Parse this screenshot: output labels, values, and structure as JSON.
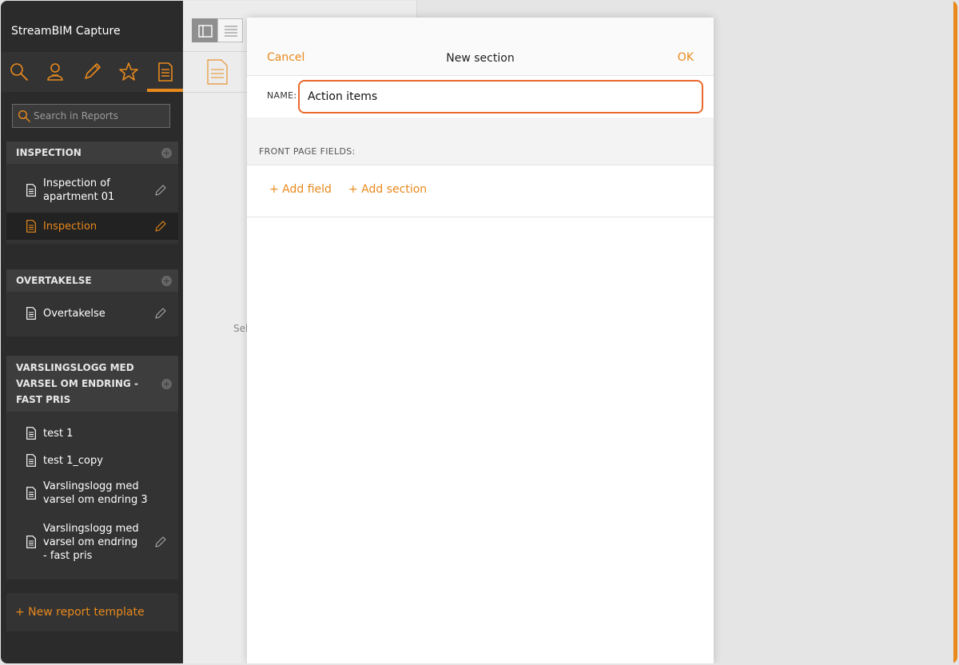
{
  "app_title": "StreamBIM Capture",
  "nav": {
    "items": [
      {
        "icon": "search-icon"
      },
      {
        "icon": "user-icon"
      },
      {
        "icon": "pencil-icon"
      },
      {
        "icon": "star-icon"
      },
      {
        "icon": "report-icon",
        "active": true
      }
    ]
  },
  "search": {
    "placeholder": "Search in Reports"
  },
  "groups": [
    {
      "title": "INSPECTION",
      "items": [
        {
          "label": "Inspection of apartment 01",
          "editable": true
        },
        {
          "label": "Inspection",
          "editable": true,
          "active": true
        }
      ]
    },
    {
      "title": "OVERTAKELSE",
      "items": [
        {
          "label": "Overtakelse",
          "editable": true
        }
      ]
    },
    {
      "title": "VARSLINGSLOGG MED VARSEL OM ENDRING - FAST PRIS",
      "items": [
        {
          "label": "test 1",
          "editable": false
        },
        {
          "label": "test 1_copy",
          "editable": false
        },
        {
          "label": "Varslingslogg med varsel om endring 3",
          "editable": false
        },
        {
          "label": "Varslingslogg med varsel om endring - fast pris",
          "editable": true
        }
      ]
    }
  ],
  "new_template_label": "+ New report template",
  "middle": {
    "select_hint": "Sel"
  },
  "modal": {
    "cancel_label": "Cancel",
    "title": "New section",
    "ok_label": "OK",
    "name_label": "NAME:",
    "name_value": "Action items",
    "front_page_fields_label": "FRONT PAGE FIELDS:",
    "add_field_label": "+ Add field",
    "add_section_label": "+ Add section"
  },
  "colors": {
    "accent": "#e8891c",
    "focus_border": "#e86a2e",
    "sidebar_bg": "#2b2b2b"
  }
}
